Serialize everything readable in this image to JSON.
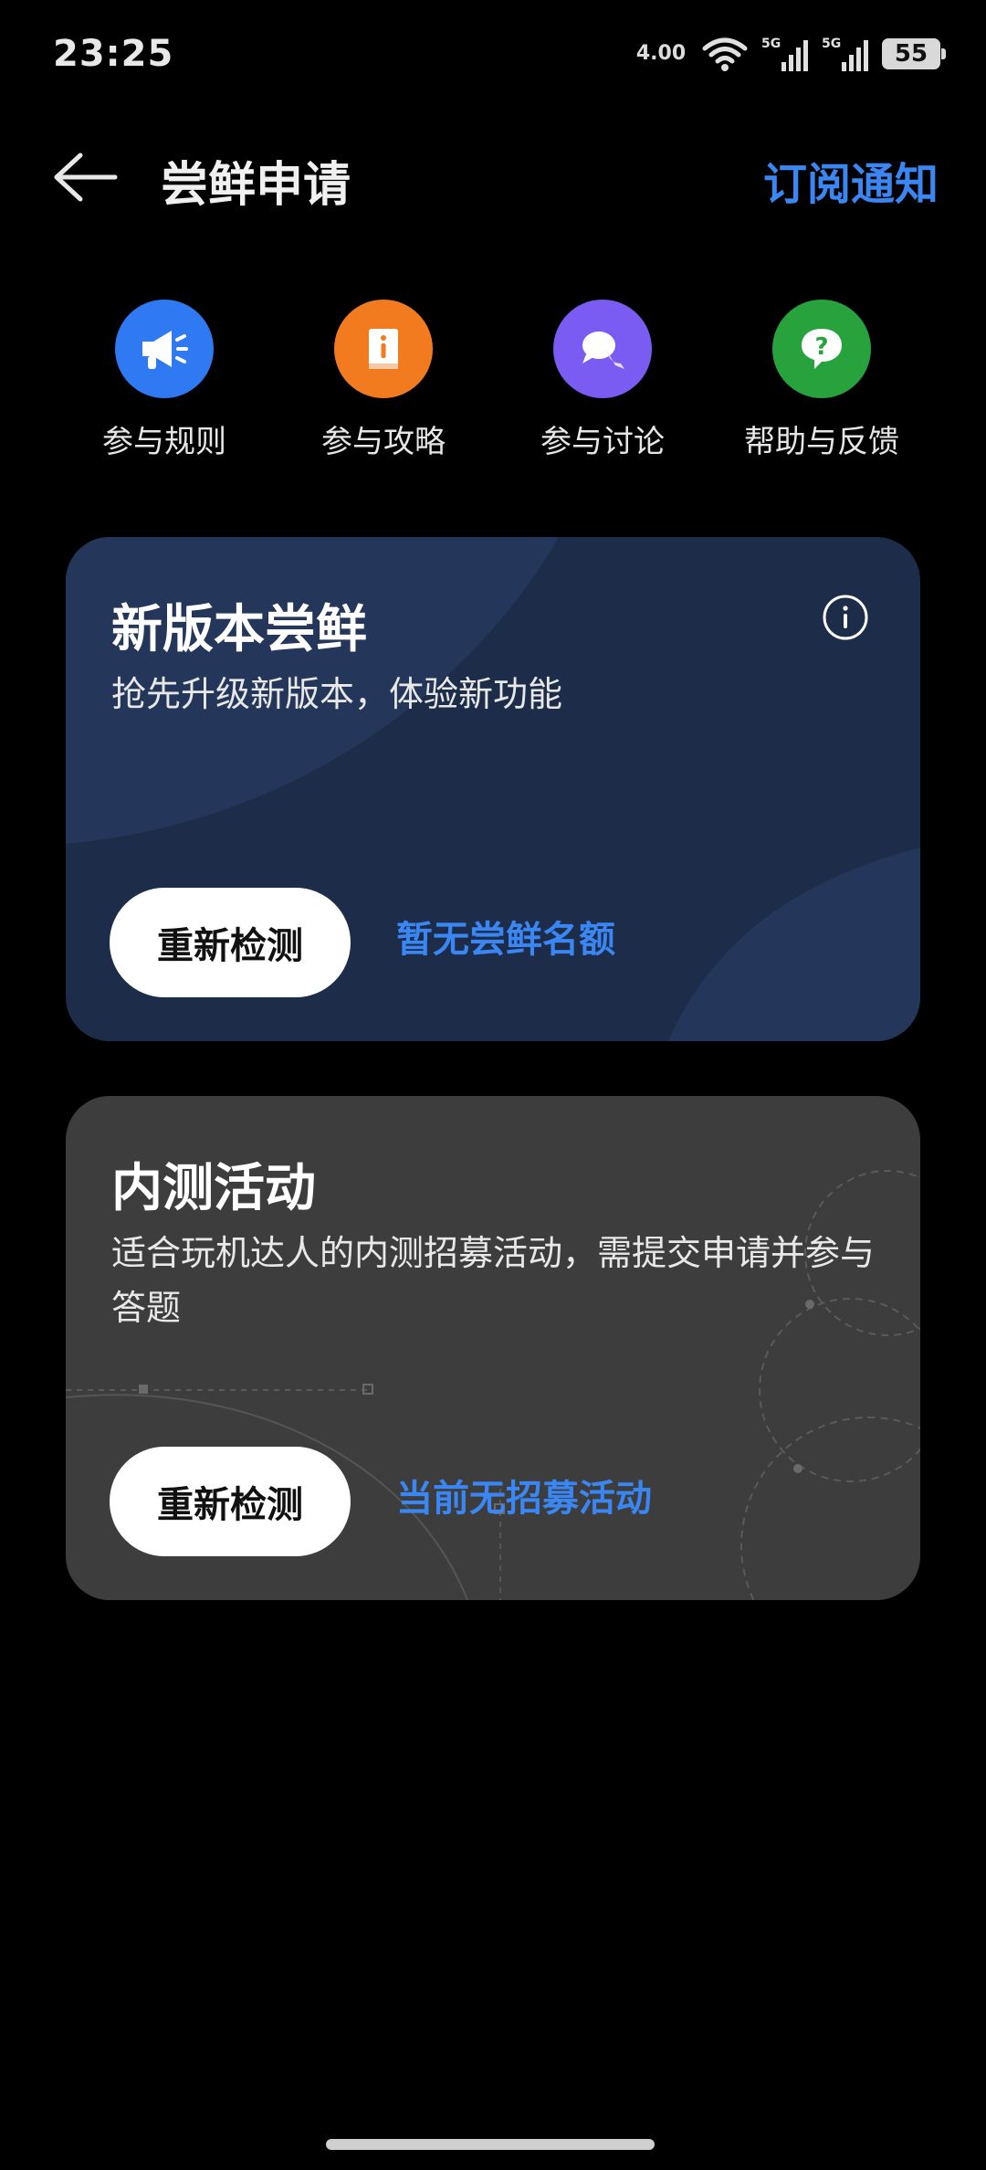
{
  "status_bar": {
    "time": "23:25",
    "net_speed": "4.00",
    "signal1_label": "5G",
    "signal2_label": "5G",
    "battery": "55"
  },
  "header": {
    "title": "尝鲜申请",
    "subscribe_label": "订阅通知"
  },
  "shortcuts": [
    {
      "label": "参与规则",
      "icon": "megaphone-icon",
      "color": "#2f7af2"
    },
    {
      "label": "参与攻略",
      "icon": "guide-book-icon",
      "color": "#f27a1f"
    },
    {
      "label": "参与讨论",
      "icon": "chat-bubbles-icon",
      "color": "#7b5cf2"
    },
    {
      "label": "帮助与反馈",
      "icon": "help-icon",
      "color": "#27a23c"
    }
  ],
  "card_new_version": {
    "title": "新版本尝鲜",
    "description": "抢先升级新版本，体验新功能",
    "button_label": "重新检测",
    "status": "暂无尝鲜名额"
  },
  "card_beta": {
    "title": "内测活动",
    "description": "适合玩机达人的内测招募活动，需提交申请并参与答题",
    "button_label": "重新检测",
    "status": "当前无招募活动"
  },
  "colors": {
    "accent": "#3a86f2",
    "card_new_bg": "#1c2c49",
    "card_beta_bg": "#3d3d3d"
  }
}
